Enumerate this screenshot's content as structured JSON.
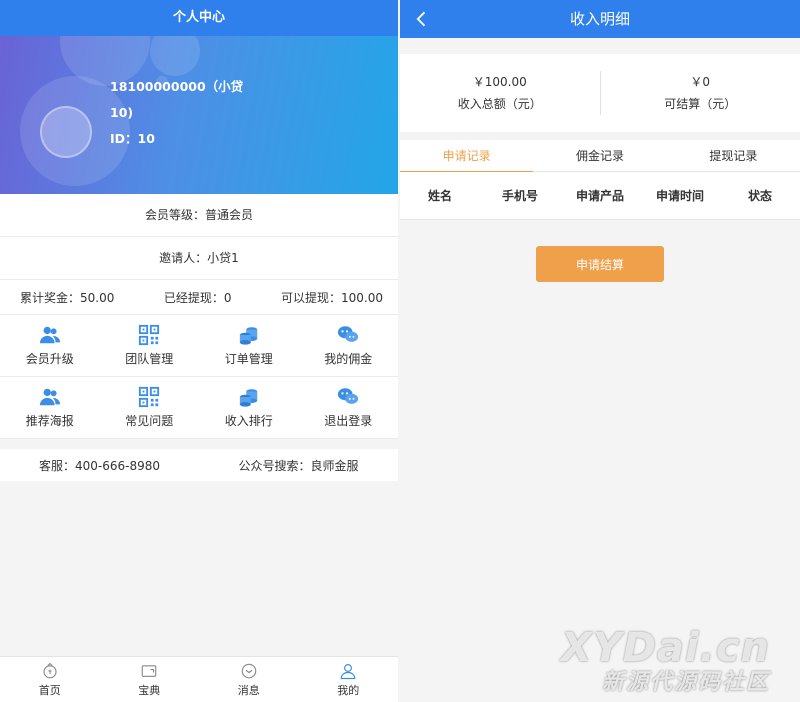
{
  "profile_page": {
    "title": "个人中心",
    "user": {
      "name_line1": "18100000000（小贷",
      "name_line2": "10)",
      "id_line": "ID：10"
    },
    "member_level": "会员等级：普通会员",
    "inviter": "邀请人：小贷1",
    "stats": {
      "total_bonus": "累计奖金：50.00",
      "withdrawn": "已经提现：0",
      "available": "可以提现：100.00"
    },
    "menu": [
      {
        "label": "会员升级",
        "icon": "users-icon",
        "color": "#3a8ee6"
      },
      {
        "label": "团队管理",
        "icon": "qrcode-icon",
        "color": "#3a8ee6"
      },
      {
        "label": "订单管理",
        "icon": "coins-icon",
        "color": "#3a8ee6"
      },
      {
        "label": "我的佣金",
        "icon": "chat-icon",
        "color": "#3a8ee6"
      },
      {
        "label": "推荐海报",
        "icon": "users-icon",
        "color": "#3a8ee6"
      },
      {
        "label": "常见问题",
        "icon": "qrcode-icon",
        "color": "#3a8ee6"
      },
      {
        "label": "收入排行",
        "icon": "coins-icon",
        "color": "#3a8ee6"
      },
      {
        "label": "退出登录",
        "icon": "chat-icon",
        "color": "#3a8ee6"
      }
    ],
    "contact": {
      "service": "客服：400-666-8980",
      "wechat": "公众号搜索：良师金服"
    },
    "tabbar": [
      {
        "label": "首页",
        "icon": "home-icon"
      },
      {
        "label": "宝典",
        "icon": "book-icon"
      },
      {
        "label": "消息",
        "icon": "message-icon"
      },
      {
        "label": "我的",
        "icon": "user-icon"
      }
    ]
  },
  "income_page": {
    "title": "收入明细",
    "back_icon": "chevron-left-icon",
    "summary": {
      "total_amount": "￥100.00",
      "total_label": "收入总额（元）",
      "settle_amount": "￥0",
      "settle_label": "可结算（元）"
    },
    "tabs": [
      "申请记录",
      "佣金记录",
      "提现记录"
    ],
    "active_tab": 0,
    "table_headers": [
      "姓名",
      "手机号",
      "申请产品",
      "申请时间",
      "状态"
    ],
    "apply_button": "申请结算"
  },
  "watermark": {
    "line1": "XYDai.cn",
    "line2": "新源代源码社区"
  },
  "colors": {
    "primary": "#2f80ed",
    "accent": "#f0a04b",
    "background": "#f4f4f4"
  }
}
